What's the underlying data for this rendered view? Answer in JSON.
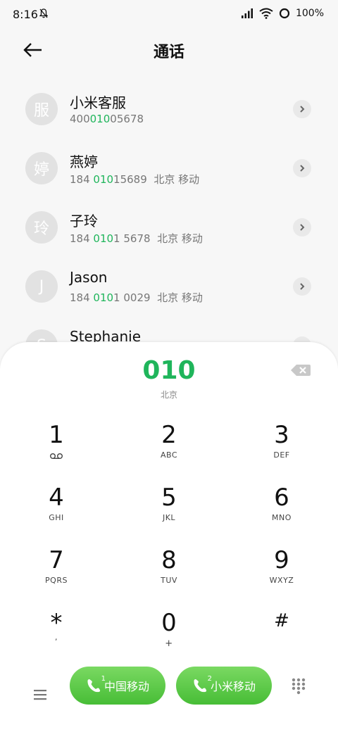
{
  "status": {
    "time": "8:16",
    "battery": "100%",
    "icons": [
      "bell-off-icon",
      "signal-icon",
      "wifi-icon",
      "battery-ring-icon"
    ]
  },
  "header": {
    "title": "通话",
    "back_icon": "back-arrow-icon"
  },
  "contacts": [
    {
      "avatar": "服",
      "name": "小米客服",
      "num_pre": "400",
      "num_hl": "010",
      "num_post": "05678",
      "location": ""
    },
    {
      "avatar": "婷",
      "name": "燕婷",
      "num_pre": "184 ",
      "num_hl": "010",
      "num_post": "15689",
      "location": "北京 移动"
    },
    {
      "avatar": "玲",
      "name": "子玲",
      "num_pre": "184 ",
      "num_hl": "010",
      "num_post": "1 5678",
      "location": "北京 移动"
    },
    {
      "avatar": "J",
      "name": "Jason",
      "num_pre": "184 ",
      "num_hl": "010",
      "num_post": "1 0029",
      "location": "北京 移动"
    },
    {
      "avatar": "S",
      "name": "Stephanie",
      "num_pre": "",
      "num_hl": "",
      "num_post": "",
      "location": ""
    }
  ],
  "dialer": {
    "number": "010",
    "location": "北京",
    "keys": [
      {
        "digit": "1",
        "letters": ""
      },
      {
        "digit": "2",
        "letters": "ABC"
      },
      {
        "digit": "3",
        "letters": "DEF"
      },
      {
        "digit": "4",
        "letters": "GHI"
      },
      {
        "digit": "5",
        "letters": "JKL"
      },
      {
        "digit": "6",
        "letters": "MNO"
      },
      {
        "digit": "7",
        "letters": "PQRS"
      },
      {
        "digit": "8",
        "letters": "TUV"
      },
      {
        "digit": "9",
        "letters": "WXYZ"
      },
      {
        "digit": "*",
        "letters": ","
      },
      {
        "digit": "0",
        "letters": "+"
      },
      {
        "digit": "#",
        "letters": ""
      }
    ]
  },
  "bottom_bar": {
    "sim1_index": "1",
    "sim1_label": "中国移动",
    "sim2_index": "2",
    "sim2_label": "小米移动",
    "accent_color": "#1fb55b",
    "button_color": "#5ccb49"
  }
}
